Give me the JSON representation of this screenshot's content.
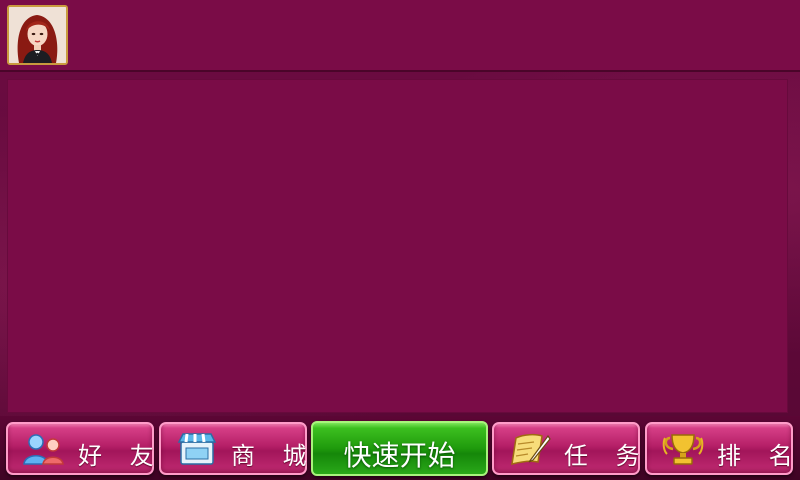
{
  "profile": {
    "avatar_icon": "player-portrait-icon"
  },
  "bottom_nav": {
    "friends": {
      "label": "好 友",
      "icon": "friends-icon"
    },
    "shop": {
      "label": "商 城",
      "icon": "shop-icon"
    },
    "quick_start": {
      "label": "快速开始"
    },
    "tasks": {
      "label": "任 务",
      "icon": "scroll-pen-icon"
    },
    "ranking": {
      "label": "排 名",
      "icon": "trophy-icon"
    }
  },
  "colors": {
    "background": "#7a0c47",
    "nav_button": "#b51f67",
    "start_button": "#1f9a0c",
    "avatar_border": "#c99a3e"
  }
}
